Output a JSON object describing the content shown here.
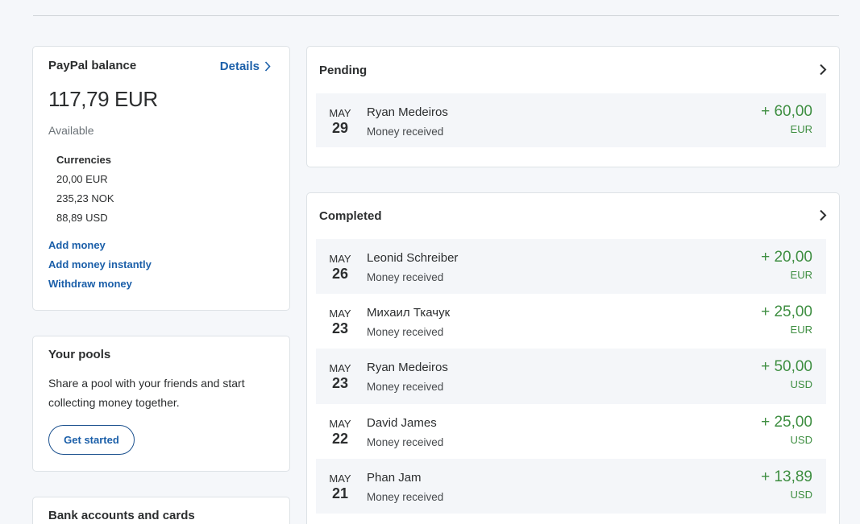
{
  "colors": {
    "page_background": "#f5f7fa",
    "card_background": "#ffffff",
    "card_border": "#dde2e6",
    "text": "#2c2e2f",
    "muted_text": "#6c7378",
    "link": "#1b5fa9",
    "positive_amount": "#3e8e41",
    "row_highlight": "#f4f6f9"
  },
  "icons": {
    "details_chevron": "chevron-right-icon",
    "section_chevron": "chevron-right-icon"
  },
  "balance": {
    "title": "PayPal balance",
    "details_label": "Details",
    "amount": "117,79 EUR",
    "available_label": "Available",
    "currencies_label": "Currencies",
    "currencies": [
      "20,00 EUR",
      "235,23 NOK",
      "88,89 USD"
    ],
    "actions": [
      "Add money",
      "Add money instantly",
      "Withdraw money"
    ]
  },
  "pools": {
    "title": "Your pools",
    "description": "Share a pool with your friends and start collecting money together.",
    "button_label": "Get started"
  },
  "bank": {
    "title": "Bank accounts and cards"
  },
  "pending": {
    "title": "Pending",
    "transactions": [
      {
        "month": "MAY",
        "day": "29",
        "name": "Ryan Medeiros",
        "status": "Money received",
        "amount": "+ 60,00",
        "currency": "EUR"
      }
    ]
  },
  "completed": {
    "title": "Completed",
    "transactions": [
      {
        "month": "MAY",
        "day": "26",
        "name": "Leonid Schreiber",
        "status": "Money received",
        "amount": "+ 20,00",
        "currency": "EUR"
      },
      {
        "month": "MAY",
        "day": "23",
        "name": "Михаил Ткачук",
        "status": "Money received",
        "amount": "+ 25,00",
        "currency": "EUR"
      },
      {
        "month": "MAY",
        "day": "23",
        "name": "Ryan Medeiros",
        "status": "Money received",
        "amount": "+ 50,00",
        "currency": "USD"
      },
      {
        "month": "MAY",
        "day": "22",
        "name": "David James",
        "status": "Money received",
        "amount": "+ 25,00",
        "currency": "USD"
      },
      {
        "month": "MAY",
        "day": "21",
        "name": "Phan Jam",
        "status": "Money received",
        "amount": "+ 13,89",
        "currency": "USD"
      }
    ]
  }
}
